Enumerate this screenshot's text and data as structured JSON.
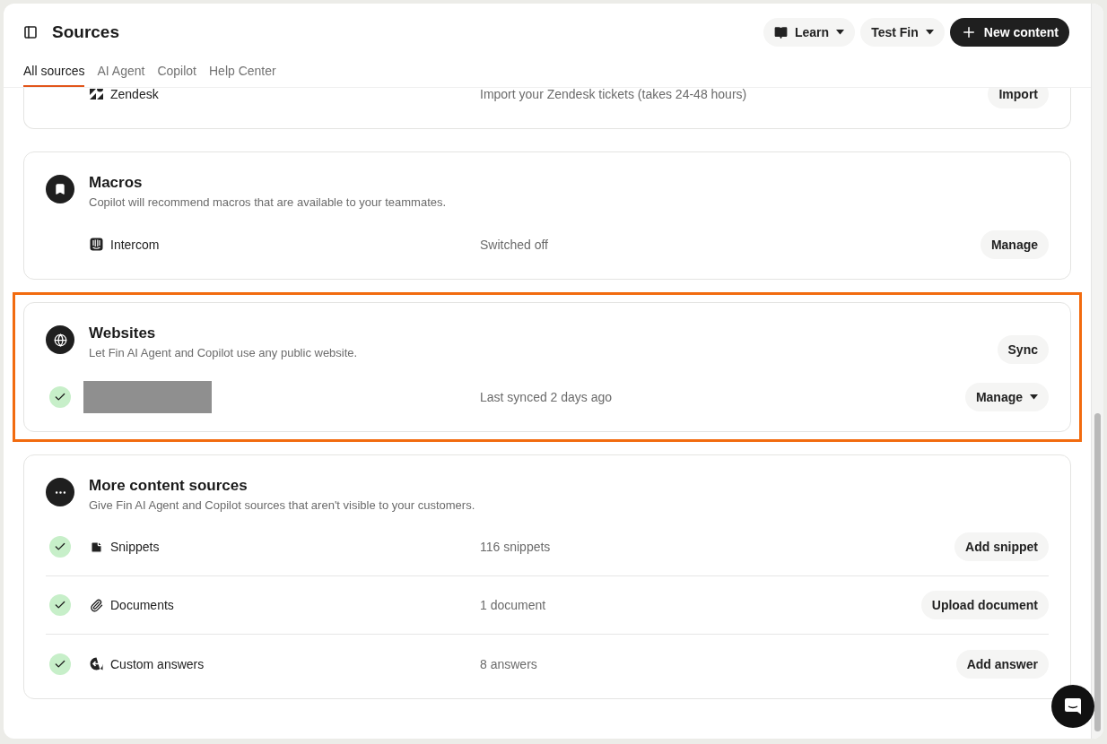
{
  "header": {
    "title": "Sources",
    "buttons": [
      {
        "label": "Learn",
        "kind": "guide"
      },
      {
        "label": "Test Fin",
        "kind": "menu"
      },
      {
        "label": "New content",
        "kind": "primary"
      }
    ]
  },
  "tabs": [
    {
      "label": "All sources",
      "selected": true
    },
    {
      "label": "AI Agent",
      "selected": false
    },
    {
      "label": "Copilot",
      "selected": false
    },
    {
      "label": "Help Center",
      "selected": false
    }
  ],
  "sections": [
    {
      "highlighted": false,
      "rows": [
        {
          "kind": "zendesk",
          "label": "Zendesk",
          "checked": false,
          "status": "Import your Zendesk tickets (takes 24-48 hours)",
          "button": "Import",
          "menu": false
        }
      ]
    },
    {
      "highlighted": false,
      "kind": "bookmark",
      "title": "Macros",
      "description": "Copilot will recommend macros that are available to your teammates.",
      "rows": [
        {
          "kind": "intercom",
          "label": "Intercom",
          "checked": false,
          "status": "Switched off",
          "button": "Manage",
          "menu": false
        }
      ]
    },
    {
      "highlighted": true,
      "kind": "globe",
      "title": "Websites",
      "description": "Let Fin AI Agent and Copilot use any public website.",
      "action": "Sync",
      "rows": [
        {
          "kind": "redacted",
          "checked": true,
          "status": "Last synced 2 days ago",
          "button": "Manage",
          "menu": true
        }
      ]
    },
    {
      "highlighted": false,
      "kind": "dots",
      "title": "More content sources",
      "description": "Give Fin AI Agent and Copilot sources that aren't visible to your customers.",
      "divided": true,
      "rows": [
        {
          "kind": "snippet",
          "label": "Snippets",
          "checked": true,
          "status": "116 snippets",
          "button": "Add snippet",
          "menu": false
        },
        {
          "kind": "document",
          "label": "Documents",
          "checked": true,
          "status": "1 document",
          "button": "Upload document",
          "menu": false
        },
        {
          "kind": "answer",
          "label": "Custom answers",
          "checked": true,
          "status": "8 answers",
          "button": "Add answer",
          "menu": false
        }
      ]
    }
  ]
}
